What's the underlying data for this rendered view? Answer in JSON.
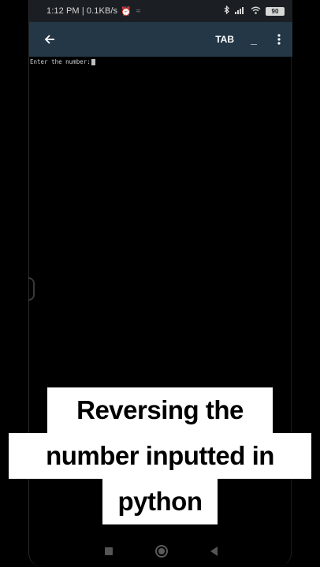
{
  "status_bar": {
    "time": "1:12 PM | 0.1KB/s",
    "battery": "90",
    "icons": [
      "alarm-icon",
      "bluetooth-icon",
      "signal-icon",
      "wifi-icon",
      "battery-icon"
    ]
  },
  "app_bar": {
    "tab_label": "TAB",
    "minimize_label": "_",
    "icons": [
      "back-arrow-icon",
      "more-vertical-icon"
    ]
  },
  "terminal": {
    "prompt": "Enter the number:"
  },
  "caption": {
    "line1": "Reversing the",
    "line2": "number inputted in",
    "line3": "python"
  },
  "nav_bar": {
    "icons": [
      "recents-square-icon",
      "home-circle-icon",
      "back-triangle-icon"
    ]
  }
}
